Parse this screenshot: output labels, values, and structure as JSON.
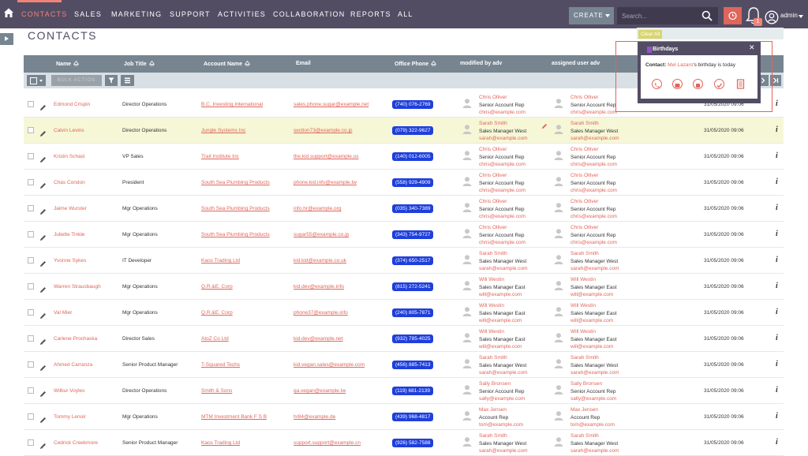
{
  "nav": {
    "items": [
      "CONTACTS",
      "SALES",
      "MARKETING",
      "SUPPORT",
      "ACTIVITIES",
      "COLLABORATION",
      "REPORTS",
      "ALL"
    ],
    "active": "CONTACTS",
    "create_label": "CREATE",
    "search_placeholder": "Search...",
    "notification_count": "1",
    "user_name": "admin"
  },
  "page": {
    "title": "CONTACTS"
  },
  "table": {
    "columns": [
      "Name",
      "Job Title",
      "Account Name",
      "Email",
      "Office Phone",
      "modified by adv",
      "assigned user adv"
    ],
    "bulk_action_label": "BULK ACTION",
    "rows": [
      {
        "name": "Edmond Crispin",
        "job": "Director Operations",
        "account": "B.C. Investing International",
        "email": "sales.phone.sugar@example.net",
        "phone": "(740) 076-2769",
        "mod": {
          "name": "Chris Olliver",
          "title": "Senior Account Rep",
          "email": "chris@example.com"
        },
        "assigned": {
          "name": "Chris Olliver",
          "title": "Senior Account Rep",
          "email": "chris@example.com"
        },
        "date": "31/05/2020 09:06"
      },
      {
        "name": "Calvin Levins",
        "job": "Director Operations",
        "account": "Jungle Systems Inc",
        "email": "section73@example.co.jp",
        "phone": "(079) 322-9627",
        "mod": {
          "name": "Sarah Smith",
          "title": "Sales Manager West",
          "email": "sarah@example.com"
        },
        "assigned": {
          "name": "Sarah Smith",
          "title": "Sales Manager West",
          "email": "sarah@example.com"
        },
        "date": "31/05/2020 09:06"
      },
      {
        "name": "Kristin Schasl",
        "job": "VP Sales",
        "account": "Trait Institute Inc",
        "email": "the.kid.support@example.us",
        "phone": "(140) 012-6005",
        "mod": {
          "name": "Chris Olliver",
          "title": "Senior Account Rep",
          "email": "chris@example.com"
        },
        "assigned": {
          "name": "Chris Olliver",
          "title": "Senior Account Rep",
          "email": "chris@example.com"
        },
        "date": "31/05/2020 09:06"
      },
      {
        "name": "Chas Condon",
        "job": "President",
        "account": "South Sea Plumbing Products",
        "email": "phone.kid.info@example.tw",
        "phone": "(558) 929-4909",
        "mod": {
          "name": "Chris Olliver",
          "title": "Senior Account Rep",
          "email": "chris@example.com"
        },
        "assigned": {
          "name": "Chris Olliver",
          "title": "Senior Account Rep",
          "email": "chris@example.com"
        },
        "date": "31/05/2020 09:06"
      },
      {
        "name": "Jaime Wurster",
        "job": "Mgr Operations",
        "account": "South Sea Plumbing Products",
        "email": "info.hr@example.org",
        "phone": "(035) 340-7389",
        "mod": {
          "name": "Chris Olliver",
          "title": "Senior Account Rep",
          "email": "chris@example.com"
        },
        "assigned": {
          "name": "Chris Olliver",
          "title": "Senior Account Rep",
          "email": "chris@example.com"
        },
        "date": "31/05/2020 09:06"
      },
      {
        "name": "Juliette Tinkle",
        "job": "Mgr Operations",
        "account": "South Sea Plumbing Products",
        "email": "sugar55@example.co.jp",
        "phone": "(343) 754-9727",
        "mod": {
          "name": "Chris Olliver",
          "title": "Senior Account Rep",
          "email": "chris@example.com"
        },
        "assigned": {
          "name": "Chris Olliver",
          "title": "Senior Account Rep",
          "email": "chris@example.com"
        },
        "date": "31/05/2020 09:06"
      },
      {
        "name": "Yvonne Sykes",
        "job": "IT Developer",
        "account": "Kaos Trading Ltd",
        "email": "kid.kid@example.co.uk",
        "phone": "(374) 650-2517",
        "mod": {
          "name": "Sarah Smith",
          "title": "Sales Manager West",
          "email": "sarah@example.com"
        },
        "assigned": {
          "name": "Sarah Smith",
          "title": "Sales Manager West",
          "email": "sarah@example.com"
        },
        "date": "31/05/2020 09:06"
      },
      {
        "name": "Warren Strausbaugh",
        "job": "Mgr Operations",
        "account": "Q.R.&E. Corp",
        "email": "kid.dev@example.info",
        "phone": "(815) 272-5241",
        "mod": {
          "name": "Will Westin",
          "title": "Sales Manager East",
          "email": "will@example.com"
        },
        "assigned": {
          "name": "Will Westin",
          "title": "Sales Manager East",
          "email": "will@example.com"
        },
        "date": "31/05/2020 09:06"
      },
      {
        "name": "Val Mier",
        "job": "Mgr Operations",
        "account": "Q.R.&E. Corp",
        "email": "phone37@example.info",
        "phone": "(240) 805-7871",
        "mod": {
          "name": "Will Westin",
          "title": "Sales Manager East",
          "email": "will@example.com"
        },
        "assigned": {
          "name": "Will Westin",
          "title": "Sales Manager East",
          "email": "will@example.com"
        },
        "date": "31/05/2020 09:06"
      },
      {
        "name": "Carlene Prochaska",
        "job": "Director Sales",
        "account": "AtoZ Co Ltd",
        "email": "kid.dev@example.net",
        "phone": "(932) 785-4025",
        "mod": {
          "name": "Will Westin",
          "title": "Sales Manager East",
          "email": "will@example.com"
        },
        "assigned": {
          "name": "Will Westin",
          "title": "Sales Manager East",
          "email": "will@example.com"
        },
        "date": "31/05/2020 09:06"
      },
      {
        "name": "Ahmed Carranza",
        "job": "Senior Product Manager",
        "account": "T-Squared Techs",
        "email": "kid.vegan.sales@example.com",
        "phone": "(456) 885-7413",
        "mod": {
          "name": "Sarah Smith",
          "title": "Sales Manager West",
          "email": "sarah@example.com"
        },
        "assigned": {
          "name": "Sarah Smith",
          "title": "Sales Manager West",
          "email": "sarah@example.com"
        },
        "date": "31/05/2020 09:06"
      },
      {
        "name": "Wilbur Voyles",
        "job": "Director Operations",
        "account": "Smith & Sons",
        "email": "qa.vegan@example.tw",
        "phone": "(119) 681-2139",
        "mod": {
          "name": "Sally Bronsen",
          "title": "Senior Account Rep",
          "email": "sally@example.com"
        },
        "assigned": {
          "name": "Sally Bronsen",
          "title": "Senior Account Rep",
          "email": "sally@example.com"
        },
        "date": "31/05/2020 09:06"
      },
      {
        "name": "Tommy Lenoir",
        "job": "Mgr Operations",
        "account": "MTM Investment Bank F S B",
        "email": "hr84@example.de",
        "phone": "(439) 968-4817",
        "mod": {
          "name": "Max Jensen",
          "title": "Account Rep",
          "email": "tom@example.com"
        },
        "assigned": {
          "name": "Max Jensen",
          "title": "Account Rep",
          "email": "tom@example.com"
        },
        "date": "31/05/2020 09:06"
      },
      {
        "name": "Cedrick Creekmore",
        "job": "Senior Product Manager",
        "account": "Kaos Trading Ltd",
        "email": "support.support@example.cn",
        "phone": "(926) 582-7588",
        "mod": {
          "name": "Sarah Smith",
          "title": "Sales Manager West",
          "email": "sarah@example.com"
        },
        "assigned": {
          "name": "Sarah Smith",
          "title": "Sales Manager West",
          "email": "sarah@example.com"
        },
        "date": "31/05/2020 09:06"
      }
    ]
  },
  "popup": {
    "clear_all": "Clear All",
    "title": "Birthdays",
    "contact_label": "Contact:",
    "contact_name": "Mel Lazaro",
    "message": "'s birthday is today",
    "actions": [
      "phone-icon",
      "meeting-icon",
      "call-log-icon",
      "task-icon",
      "note-icon"
    ]
  },
  "colors": {
    "nav_bg": "#534d64",
    "accent": "#f08377",
    "link": "#e0655a",
    "header_bg": "#778591",
    "phone_badge": "#1f3fdc",
    "highlight_row": "#f6f7d6"
  }
}
